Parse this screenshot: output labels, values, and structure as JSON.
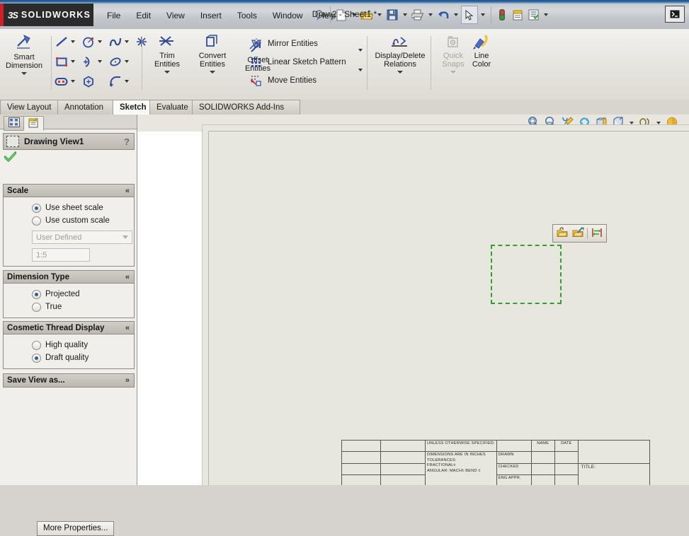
{
  "app": {
    "brand_ds": "ĐS",
    "brand_name": "SOLIDWORKS",
    "document_title": "Draw2 - Sheet1 *",
    "restore_glyph": "▤"
  },
  "menu": {
    "items": [
      {
        "label": "File",
        "name": "menu-file"
      },
      {
        "label": "Edit",
        "name": "menu-edit"
      },
      {
        "label": "View",
        "name": "menu-view"
      },
      {
        "label": "Insert",
        "name": "menu-insert"
      },
      {
        "label": "Tools",
        "name": "menu-tools"
      },
      {
        "label": "Window",
        "name": "menu-window"
      },
      {
        "label": "Help",
        "name": "menu-help"
      }
    ]
  },
  "quick_access": {
    "buttons": [
      {
        "icon": "pin-icon",
        "name": "pin-menu-button"
      },
      {
        "icon": "new-document-icon",
        "name": "new-button"
      },
      {
        "icon": "open-folder-icon",
        "name": "open-button"
      },
      {
        "icon": "save-icon",
        "name": "save-button"
      },
      {
        "icon": "print-icon",
        "name": "print-button"
      },
      {
        "icon": "undo-icon",
        "name": "undo-button"
      },
      {
        "icon": "select-cursor-icon",
        "name": "select-button"
      },
      {
        "icon": "rebuild-traffic-light-icon",
        "name": "rebuild-button"
      },
      {
        "icon": "sheet-properties-icon",
        "name": "sheet-properties-button"
      },
      {
        "icon": "options-icon",
        "name": "options-button"
      }
    ]
  },
  "ribbon": {
    "groups": [
      {
        "name": "smart-dimension-group",
        "buttons": [
          {
            "label": "Smart\nDimension",
            "label_line1": "Smart",
            "label_line2": "Dimension",
            "name": "smart-dimension-button"
          }
        ]
      },
      {
        "name": "sketch-entities-group",
        "tools": [
          {
            "icon": "line-icon",
            "name": "line-tool",
            "dropdown": true
          },
          {
            "icon": "circle-icon",
            "name": "circle-tool",
            "dropdown": true
          },
          {
            "icon": "spline-icon",
            "name": "spline-tool",
            "dropdown": true
          },
          {
            "icon": "point-icon",
            "name": "point-tool",
            "dropdown": false
          },
          {
            "icon": "rectangle-icon",
            "name": "rectangle-tool",
            "dropdown": true
          },
          {
            "icon": "arc-3point-icon",
            "name": "arc-tool",
            "dropdown": true
          },
          {
            "icon": "ellipse-icon",
            "name": "ellipse-tool",
            "dropdown": true
          },
          {
            "icon": "slot-icon",
            "name": "slot-tool",
            "dropdown": true
          },
          {
            "icon": "polygon-icon",
            "name": "polygon-tool",
            "dropdown": false
          },
          {
            "icon": "fillet-icon",
            "name": "sketch-fillet-tool",
            "dropdown": true
          }
        ]
      },
      {
        "name": "edit-tools-group",
        "buttons": [
          {
            "label_line1": "Trim",
            "label_line2": "Entities",
            "name": "trim-entities-button",
            "icon": "trim-icon",
            "dropdown": true
          },
          {
            "label_line1": "Convert",
            "label_line2": "Entities",
            "name": "convert-entities-button",
            "icon": "convert-icon",
            "dropdown": true
          },
          {
            "label_line1": "Offset",
            "label_line2": "Entities",
            "name": "offset-entities-button",
            "icon": "offset-icon",
            "dropdown": false
          }
        ]
      },
      {
        "name": "pattern-tools-group",
        "rows": [
          {
            "label": "Mirror Entities",
            "name": "mirror-entities-item",
            "icon": "mirror-icon",
            "dropdown": false
          },
          {
            "label": "Linear Sketch Pattern",
            "name": "linear-sketch-pattern-item",
            "icon": "linear-pattern-icon",
            "dropdown": true
          },
          {
            "label": "Move Entities",
            "name": "move-entities-item",
            "icon": "move-entities-icon",
            "dropdown": true
          }
        ]
      },
      {
        "name": "relations-group",
        "buttons": [
          {
            "label_line1": "Display/Delete",
            "label_line2": "Relations",
            "name": "display-delete-relations-button",
            "icon": "relations-icon",
            "dropdown": true
          }
        ]
      },
      {
        "name": "quick-snaps-group",
        "buttons": [
          {
            "label_line1": "Quick",
            "label_line2": "Snaps",
            "name": "quick-snaps-button",
            "icon": "quick-snaps-icon",
            "dropdown": true,
            "disabled": true
          }
        ]
      },
      {
        "name": "line-color-group",
        "buttons": [
          {
            "label_line1": "Line",
            "label_line2": "Color",
            "name": "line-color-button",
            "icon": "line-color-icon",
            "dropdown": false
          }
        ]
      }
    ]
  },
  "command_tabs": {
    "items": [
      {
        "label": "View Layout",
        "name": "tab-view-layout",
        "active": false
      },
      {
        "label": "Annotation",
        "name": "tab-annotation",
        "active": false
      },
      {
        "label": "Sketch",
        "name": "tab-sketch",
        "active": true
      },
      {
        "label": "Evaluate",
        "name": "tab-evaluate",
        "active": false
      },
      {
        "label": "SOLIDWORKS Add-Ins",
        "name": "tab-solidworks-addins",
        "active": false
      }
    ]
  },
  "property_manager": {
    "tabs": [
      {
        "icon": "feature-tree-icon",
        "name": "feature-manager-tab",
        "active": false
      },
      {
        "icon": "property-manager-icon",
        "name": "property-manager-tab",
        "active": true
      }
    ],
    "header": {
      "title": "Drawing View1",
      "help_glyph": "?",
      "icon": "drawing-view-icon"
    },
    "ok_button": {
      "name": "ok-checkmark-button",
      "icon": "green-check-icon"
    },
    "sections": [
      {
        "name": "scale-section",
        "title": "Scale",
        "chevron": "«",
        "collapsed": false,
        "radios": [
          {
            "label": "Use sheet scale",
            "selected": true,
            "disabled": false,
            "name": "radio-use-sheet-scale"
          },
          {
            "label": "Use custom scale",
            "selected": false,
            "disabled": false,
            "name": "radio-use-custom-scale"
          }
        ],
        "dropdown": {
          "value": "User Defined",
          "name": "scale-preset-dropdown",
          "disabled": true
        },
        "textbox": {
          "value": "1:5",
          "name": "custom-scale-input",
          "disabled": true
        }
      },
      {
        "name": "dimension-type-section",
        "title": "Dimension Type",
        "chevron": "«",
        "collapsed": false,
        "radios": [
          {
            "label": "Projected",
            "selected": true,
            "disabled": false,
            "name": "radio-projected"
          },
          {
            "label": "True",
            "selected": false,
            "disabled": false,
            "name": "radio-true"
          }
        ]
      },
      {
        "name": "cosmetic-thread-display-section",
        "title": "Cosmetic Thread Display",
        "chevron": "«",
        "collapsed": false,
        "radios": [
          {
            "label": "High quality",
            "selected": false,
            "disabled": false,
            "name": "radio-high-quality"
          },
          {
            "label": "Draft quality",
            "selected": true,
            "disabled": false,
            "name": "radio-draft-quality"
          }
        ]
      }
    ],
    "save_view_as": {
      "title": "Save View as...",
      "chevron": "»",
      "name": "save-view-as-section"
    },
    "more_properties_button": {
      "label": "More Properties...",
      "name": "more-properties-button"
    }
  },
  "view_toolbar": {
    "buttons": [
      {
        "icon": "zoom-to-fit-icon",
        "name": "zoom-to-fit-button"
      },
      {
        "icon": "zoom-to-area-icon",
        "name": "zoom-to-area-button"
      },
      {
        "icon": "previous-view-icon",
        "name": "previous-view-button"
      },
      {
        "icon": "rebuild-icon",
        "name": "rebuild-view-button"
      },
      {
        "icon": "section-view-icon",
        "name": "section-view-button"
      },
      {
        "icon": "view-orientation-icon",
        "name": "view-orientation-button",
        "dropdown": true
      },
      {
        "icon": "display-style-icon",
        "name": "display-style-button",
        "dropdown": true
      },
      {
        "icon": "apply-scene-icon",
        "name": "apply-scene-button"
      }
    ]
  },
  "canvas": {
    "selection_rect": {
      "name": "drawing-view-selection-rect",
      "color": "#2fa02f"
    },
    "context_toolbar": {
      "name": "view-context-toolbar",
      "buttons": [
        {
          "icon": "lock-view-position-icon",
          "name": "lock-view-position-button"
        },
        {
          "icon": "unlock-view-focus-icon",
          "name": "view-focus-button"
        },
        {
          "icon": "align-view-icon",
          "name": "align-view-button"
        }
      ]
    }
  },
  "title_block": {
    "unless_note": "UNLESS OTHERWISE SPECIFIED:",
    "notes": [
      "DIMENSIONS ARE IN INCHES",
      "TOLERANCES:",
      "FRACTIONAL±",
      "ANGULAR: MACH±    BEND ±"
    ],
    "columns": [
      "NAME",
      "DATE"
    ],
    "rows": [
      "DRAWN",
      "CHECKED",
      "ENG APPR."
    ],
    "title_label": "TITLE:"
  }
}
